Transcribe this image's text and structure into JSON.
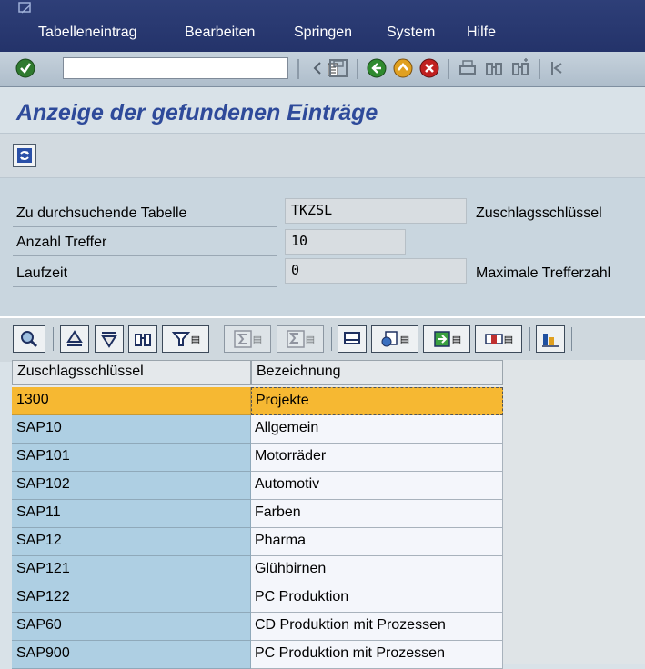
{
  "menu": {
    "items": [
      "Tabelleneintrag",
      "Bearbeiten",
      "Springen",
      "System",
      "Hilfe"
    ]
  },
  "toolbar": {
    "command_field_value": ""
  },
  "page": {
    "title": "Anzeige der gefundenen Einträge"
  },
  "fields": {
    "table_label": "Zu durchsuchende Tabelle",
    "table_value": "TKZSL",
    "table_desc": "Zuschlagsschlüssel",
    "hits_label": "Anzahl Treffer",
    "hits_value": "10",
    "runtime_label": "Laufzeit",
    "runtime_value": "0",
    "max_label": "Maximale Trefferzahl"
  },
  "grid": {
    "columns": [
      "Zuschlagsschlüssel",
      "Bezeichnung"
    ],
    "rows": [
      {
        "key": "1300",
        "desc": "Projekte"
      },
      {
        "key": "SAP10",
        "desc": "Allgemein"
      },
      {
        "key": "SAP101",
        "desc": "Motorräder"
      },
      {
        "key": "SAP102",
        "desc": "Automotiv"
      },
      {
        "key": "SAP11",
        "desc": "Farben"
      },
      {
        "key": "SAP12",
        "desc": "Pharma"
      },
      {
        "key": "SAP121",
        "desc": "Glühbirnen"
      },
      {
        "key": "SAP122",
        "desc": "PC Produktion"
      },
      {
        "key": "SAP60",
        "desc": "CD Produktion mit  Prozessen"
      },
      {
        "key": "SAP900",
        "desc": "PC Produktion mit Prozessen"
      }
    ],
    "selected_row": 0
  },
  "colors": {
    "menubar": "#2e3f78",
    "title": "#2e4a9a",
    "key_column": "#aecfe3",
    "selected_row": "#f6b832"
  }
}
